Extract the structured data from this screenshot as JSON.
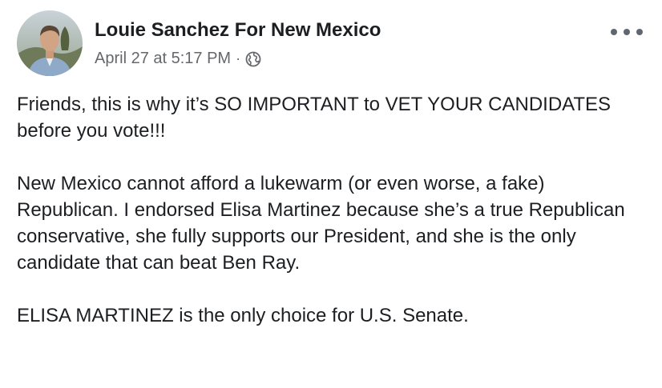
{
  "post": {
    "author": "Louie Sanchez For New Mexico",
    "timestamp": "April 27 at 5:17 PM",
    "separator": "·",
    "audience_icon": "globe-icon",
    "menu_icon": "more-options-icon",
    "paragraphs": [
      "Friends, this is why it’s SO IMPORTANT to VET YOUR CANDIDATES before you vote!!!",
      "New Mexico cannot afford a lukewarm (or even worse, a fake) Republican.  I endorsed Elisa Martinez because she’s a true Republican conservative, she fully supports our President, and she is the only candidate that can beat Ben Ray.",
      "ELISA MARTINEZ is the only choice for U.S. Senate."
    ]
  },
  "colors": {
    "text_primary": "#1c1e21",
    "text_secondary": "#65676b",
    "icon": "#606770",
    "background": "#ffffff"
  }
}
